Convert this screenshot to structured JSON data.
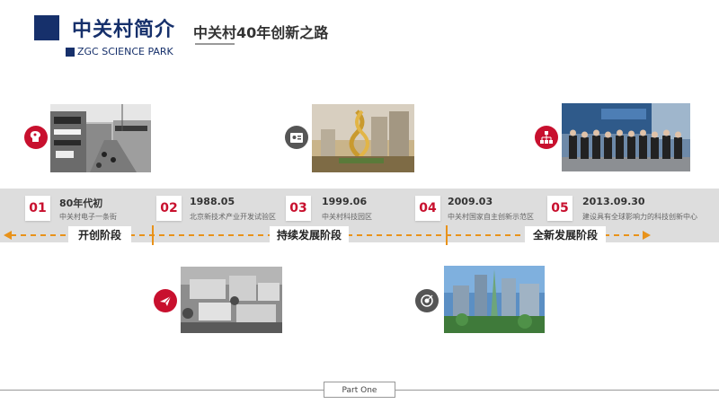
{
  "header": {
    "title": "中关村简介",
    "subtitle": "中关村40年创新之路",
    "english_title": "ZGC SCIENCE PARK"
  },
  "timeline": {
    "events": [
      {
        "number": "01",
        "date": "80年代初",
        "desc": "中关村电子一条街"
      },
      {
        "number": "02",
        "date": "1988.05",
        "desc": "北京新技术产业开发试验区"
      },
      {
        "number": "03",
        "date": "1999.06",
        "desc": "中关村科技园区"
      },
      {
        "number": "04",
        "date": "2009.03",
        "desc": "中关村国家自主创新示范区"
      },
      {
        "number": "05",
        "date": "2013.09.30",
        "desc": "建设具有全球影响力的科技创新中心"
      }
    ],
    "phases": [
      {
        "label": "开创阶段"
      },
      {
        "label": "持续发展阶段"
      },
      {
        "label": "全新发展阶段"
      }
    ]
  },
  "icons": {
    "photo1": "lightbulb-head-icon",
    "photo2": "id-card-icon",
    "photo3": "org-chart-icon",
    "photo4": "paper-plane-icon",
    "photo5": "target-icon"
  },
  "colors": {
    "navy": "#16306b",
    "red": "#c8102e",
    "orange": "#e8921a",
    "gray": "#555555"
  },
  "footer": {
    "label": "Part One"
  }
}
